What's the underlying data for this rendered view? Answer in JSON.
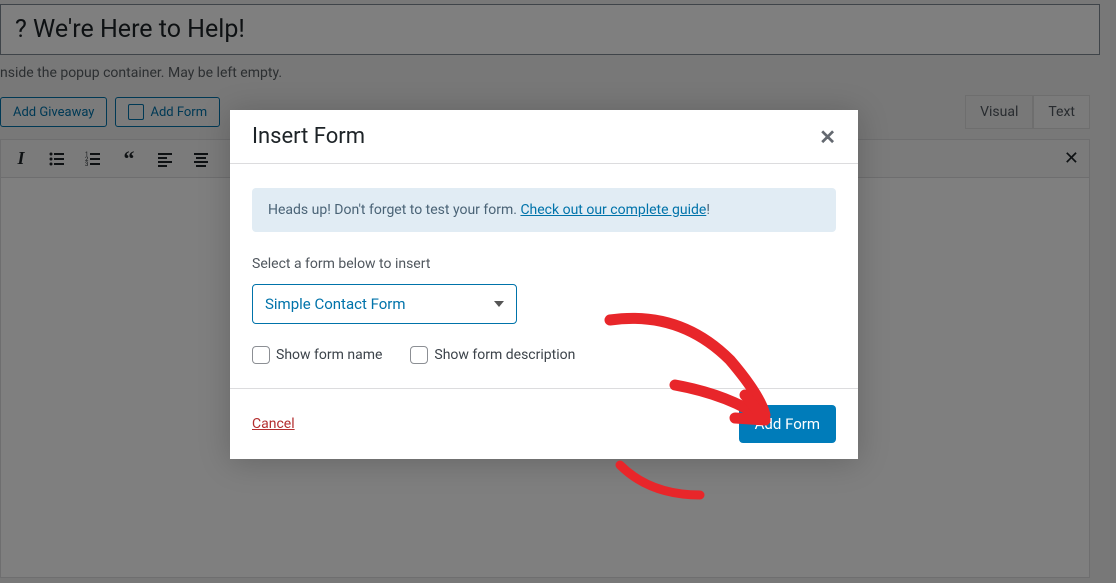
{
  "editor": {
    "title_value": "? We're Here to Help!",
    "hint": "nside the popup container. May be left empty.",
    "buttons": {
      "add_giveaway": "Add Giveaway",
      "add_form": "Add Form"
    },
    "tabs": {
      "visual": "Visual",
      "text": "Text"
    }
  },
  "modal": {
    "title": "Insert Form",
    "alert_prefix": "Heads up! Don't forget to test your form. ",
    "alert_link": "Check out our complete guide",
    "alert_suffix": "!",
    "instruction": "Select a form below to insert",
    "selected_form": "Simple Contact Form",
    "checkbox_name_label": "Show form name",
    "checkbox_desc_label": "Show form description",
    "cancel": "Cancel",
    "add_form": "Add Form"
  }
}
